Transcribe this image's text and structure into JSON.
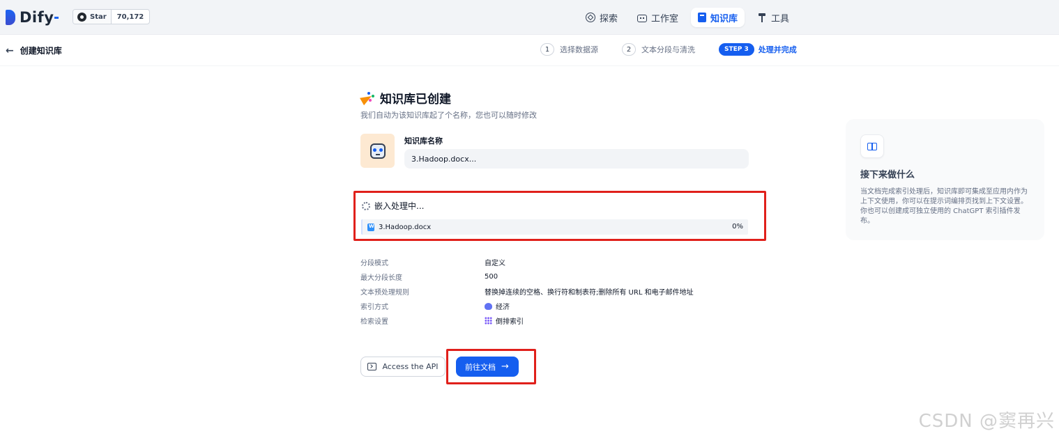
{
  "app": {
    "logo_text": "Dify",
    "github_star_label": "Star",
    "github_star_count": "70,172"
  },
  "nav": {
    "items": [
      {
        "label": "探索",
        "icon": "compass-icon",
        "active": false
      },
      {
        "label": "工作室",
        "icon": "robot-icon",
        "active": false
      },
      {
        "label": "知识库",
        "icon": "book-icon",
        "active": true
      },
      {
        "label": "工具",
        "icon": "hammer-icon",
        "active": false
      }
    ]
  },
  "subheader": {
    "back_label": "创建知识库",
    "steps": [
      {
        "num": "1",
        "label": "选择数据源"
      },
      {
        "num": "2",
        "label": "文本分段与清洗"
      },
      {
        "num": "STEP 3",
        "label": "处理并完成"
      }
    ]
  },
  "main": {
    "title": "知识库已创建",
    "subtitle": "我们自动为该知识库起了个名称，您也可以随时修改",
    "name_label": "知识库名称",
    "name_value": "3.Hadoop.docx...",
    "processing_title": "嵌入处理中...",
    "file_name": "3.Hadoop.docx",
    "file_progress": "0%",
    "settings": [
      {
        "key": "分段模式",
        "value": "自定义"
      },
      {
        "key": "最大分段长度",
        "value": "500"
      },
      {
        "key": "文本预处理规则",
        "value": "替换掉连续的空格、换行符和制表符;删除所有 URL 和电子邮件地址"
      },
      {
        "key": "索引方式",
        "value": "经济"
      },
      {
        "key": "检索设置",
        "value": "倒排索引"
      }
    ],
    "api_button": "Access the API",
    "go_button": "前往文档"
  },
  "card": {
    "title": "接下来做什么",
    "body": "当文档完成索引处理后，知识库即可集成至应用内作为上下文使用，你可以在提示词编排页找到上下文设置。你也可以创建成可独立使用的 ChatGPT 索引插件发布。"
  },
  "watermark": "CSDN @窦再兴",
  "colors": {
    "accent": "#155eef",
    "highlight_border": "#e0201b"
  }
}
